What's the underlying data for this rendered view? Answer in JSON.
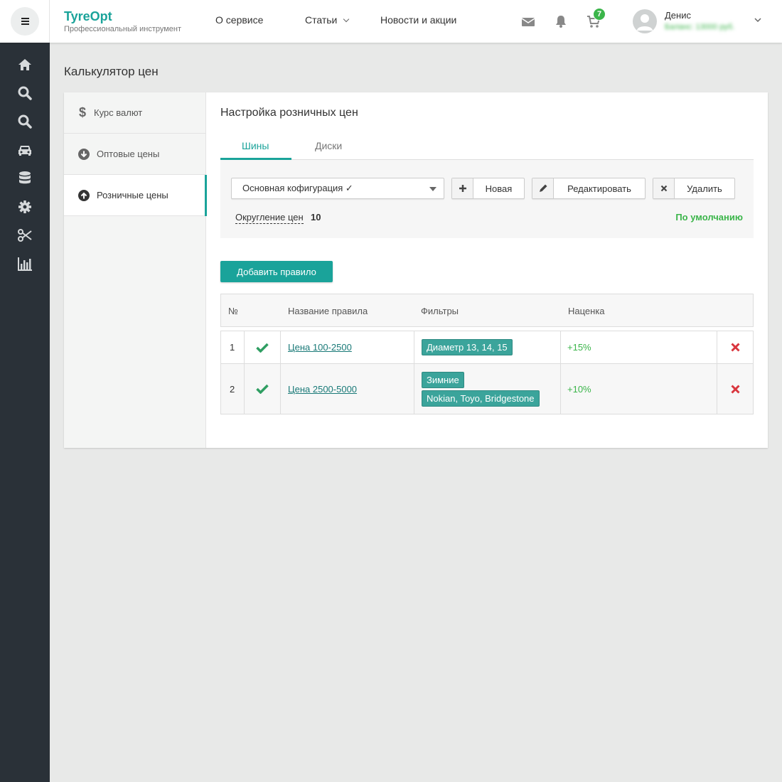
{
  "header": {
    "logo_title": "TyreOpt",
    "logo_subtitle": "Профессиональный инструмент",
    "nav": [
      {
        "label": "О сервисе"
      },
      {
        "label": "Статьи"
      },
      {
        "label": "Новости и акции"
      }
    ],
    "cart_count": "7",
    "user_name": "Денис",
    "user_balance": "Баланс: 13000 руб."
  },
  "page": {
    "title": "Калькулятор цен"
  },
  "left_menu": [
    {
      "label": "Курс валют"
    },
    {
      "label": "Оптовые цены"
    },
    {
      "label": "Розничные цены"
    }
  ],
  "section": {
    "title": "Настройка розничных цен",
    "tabs": [
      {
        "label": "Шины"
      },
      {
        "label": "Диски"
      }
    ],
    "config_select": "Основная кофигурация ✓",
    "btn_new": "Новая",
    "btn_edit": "Редактировать",
    "btn_delete": "Удалить",
    "rounding_label": "Округление цен",
    "rounding_value": "10",
    "default_label": "По умолчанию",
    "add_rule": "Добавить правило"
  },
  "table": {
    "headers": {
      "num": "№",
      "name": "Название правила",
      "filters": "Фильтры",
      "markup": "Наценка"
    },
    "rows": [
      {
        "num": "1",
        "name": "Цена 100-2500",
        "filters": [
          "Диаметр 13, 14, 15"
        ],
        "markup": "+15%"
      },
      {
        "num": "2",
        "name": "Цена 2500-5000",
        "filters": [
          "Зимние",
          "Nokian, Toyo, Bridgestone"
        ],
        "markup": "+10%"
      }
    ]
  },
  "colors": {
    "accent": "#1aa39a",
    "sidebar": "#2a3138",
    "success": "#3bb54a",
    "danger": "#d9363e"
  }
}
